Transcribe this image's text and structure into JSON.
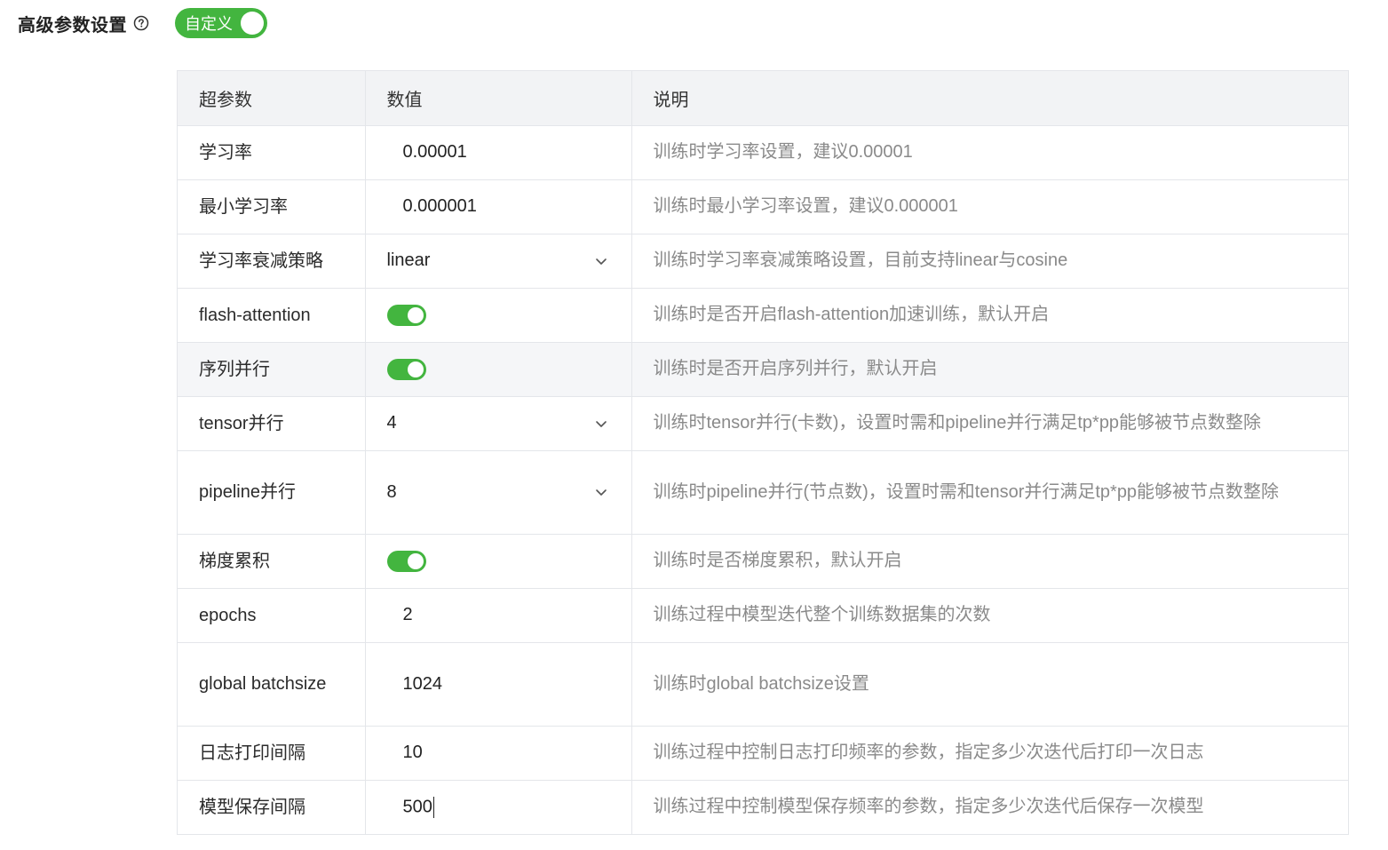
{
  "header": {
    "title": "高级参数设置",
    "help_icon": "question-circle-icon",
    "custom_toggle": {
      "label": "自定义",
      "checked": true
    }
  },
  "table": {
    "headers": [
      "超参数",
      "数值",
      "说明"
    ],
    "rows": [
      {
        "name": "学习率",
        "type": "input",
        "value": "0.00001",
        "desc": "训练时学习率设置，建议0.00001"
      },
      {
        "name": "最小学习率",
        "type": "input",
        "value": "0.000001",
        "desc": "训练时最小学习率设置，建议0.000001"
      },
      {
        "name": "学习率衰减策略",
        "type": "select",
        "value": "linear",
        "desc": "训练时学习率衰减策略设置，目前支持linear与cosine"
      },
      {
        "name": "flash-attention",
        "type": "switch",
        "checked": true,
        "desc": "训练时是否开启flash-attention加速训练，默认开启"
      },
      {
        "name": "序列并行",
        "type": "switch",
        "checked": true,
        "desc": "训练时是否开启序列并行，默认开启"
      },
      {
        "name": "tensor并行",
        "type": "select",
        "value": "4",
        "desc": "训练时tensor并行(卡数)，设置时需和pipeline并行满足tp*pp能够被节点数整除"
      },
      {
        "name": "pipeline并行",
        "type": "select",
        "value": "8",
        "desc": "训练时pipeline并行(节点数)，设置时需和tensor并行满足tp*pp能够被节点数整除"
      },
      {
        "name": "梯度累积",
        "type": "switch",
        "checked": true,
        "desc": "训练时是否梯度累积，默认开启"
      },
      {
        "name": "epochs",
        "type": "input",
        "value": "2",
        "desc": "训练过程中模型迭代整个训练数据集的次数"
      },
      {
        "name": "global batchsize",
        "type": "input",
        "value": "1024",
        "desc": "训练时global batchsize设置"
      },
      {
        "name": "日志打印间隔",
        "type": "input",
        "value": "10",
        "desc": "训练过程中控制日志打印频率的参数，指定多少次迭代后打印一次日志"
      },
      {
        "name": "模型保存间隔",
        "type": "input",
        "value": "500",
        "desc": "训练过程中控制模型保存频率的参数，指定多少次迭代后保存一次模型"
      }
    ]
  },
  "colors": {
    "accent_green": "#43b53f",
    "header_bg": "#f2f3f5",
    "border": "#e4e6ea",
    "desc_text": "#8a8a8a"
  }
}
